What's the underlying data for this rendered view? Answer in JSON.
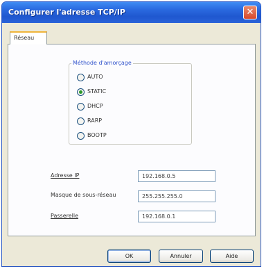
{
  "window": {
    "title": "Configurer l'adresse TCP/IP"
  },
  "tabs": [
    {
      "label": "Réseau"
    }
  ],
  "boot_method": {
    "legend": "Méthode d'amorçage",
    "options": [
      {
        "label": "AUTO",
        "selected": false
      },
      {
        "label": "STATIC",
        "selected": true
      },
      {
        "label": "DHCP",
        "selected": false
      },
      {
        "label": "RARP",
        "selected": false
      },
      {
        "label": "BOOTP",
        "selected": false
      }
    ]
  },
  "fields": {
    "ip": {
      "label": "Adresse IP",
      "value": "192.168.0.5"
    },
    "mask": {
      "label": "Masque de sous-réseau",
      "value": "255.255.255.0"
    },
    "gateway": {
      "label": "Passerelle",
      "value": "192.168.0.1"
    }
  },
  "buttons": {
    "ok": "OK",
    "cancel": "Annuler",
    "help": "Aide"
  }
}
